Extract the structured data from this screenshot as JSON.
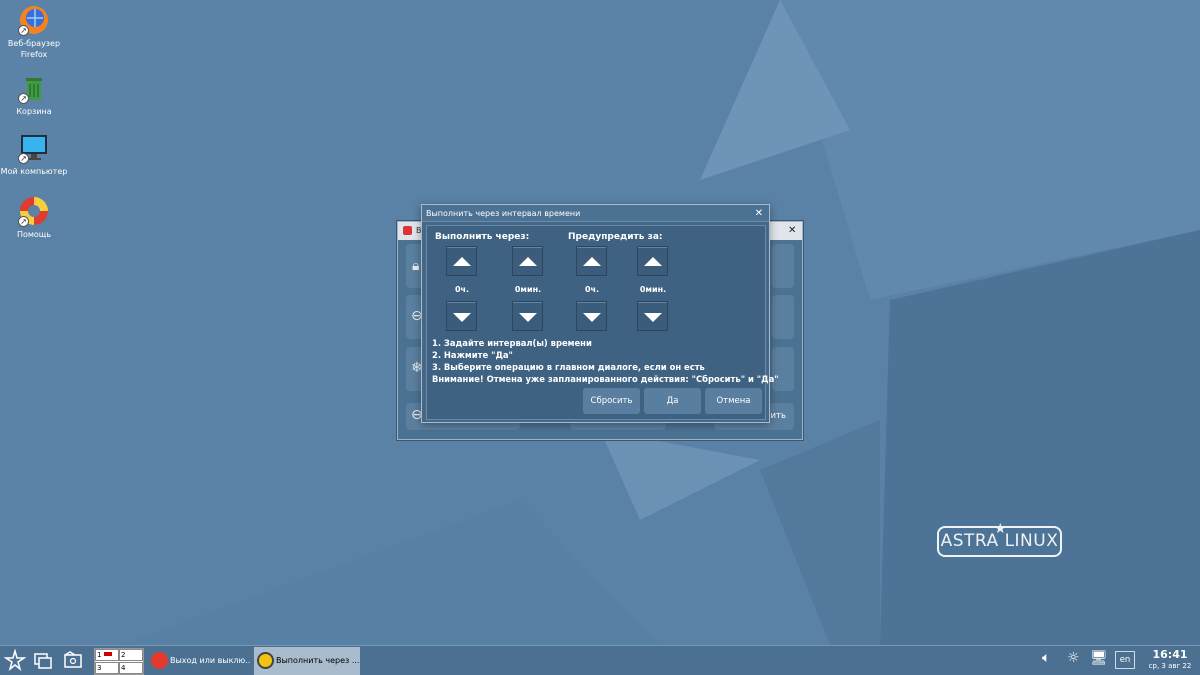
{
  "desktop": {
    "icons": [
      {
        "label": "Веб-браузер Firefox",
        "icon": "firefox-icon"
      },
      {
        "label": "Корзина",
        "icon": "trash-icon"
      },
      {
        "label": "Мой компьютер",
        "icon": "computer-icon"
      },
      {
        "label": "Помощь",
        "icon": "help-lifebuoy-icon"
      }
    ],
    "logo": "ASTRA LINUX",
    "colors": {
      "background": "#5a82a6",
      "accent": "#4c7293"
    }
  },
  "background_window": {
    "title_partial": "Вы",
    "close_glyph": "✕",
    "button_partial": "ить"
  },
  "dialog": {
    "title": "Выполнить через интервал времени",
    "close_glyph": "✕",
    "run_after_label": "Выполнить через:",
    "warn_before_label": "Предупредить за:",
    "spinners": [
      {
        "value": "0ч."
      },
      {
        "value": "0мин."
      },
      {
        "value": "0ч."
      },
      {
        "value": "0мин."
      }
    ],
    "instructions": [
      "1. Задайте интервал(ы) времени",
      "2. Нажмите \"Да\"",
      "3. Выберите операцию в главном диалоге, если он есть",
      "Внимание! Отмена уже запланированного действия: \"Сбросить\" и \"Да\""
    ],
    "buttons": {
      "reset": "Сбросить",
      "yes": "Да",
      "cancel": "Отмена"
    }
  },
  "taskbar": {
    "pager": [
      "1",
      "2",
      "3",
      "4"
    ],
    "tasks": [
      {
        "label": "Выход или выклю...",
        "icon": "power-icon",
        "active": false
      },
      {
        "label": "Выполнить через ...",
        "icon": "alarm-clock-icon",
        "active": true
      }
    ],
    "language": "en",
    "time": "16:41",
    "date": "ср, 3 авг 22"
  }
}
